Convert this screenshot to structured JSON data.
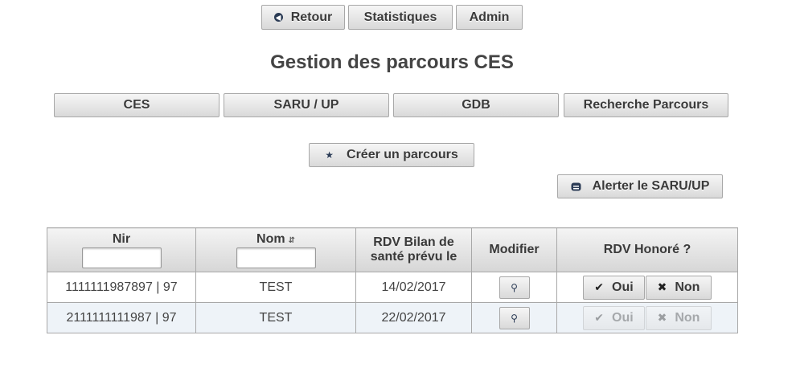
{
  "nav": {
    "back": "Retour",
    "stats": "Statistiques",
    "admin": "Admin"
  },
  "page_title": "Gestion des parcours CES",
  "tabs": [
    "CES",
    "SARU / UP",
    "GDB",
    "Recherche Parcours"
  ],
  "actions": {
    "create": "Créer un parcours",
    "alert": "Alerter le SARU/UP"
  },
  "table": {
    "headers": {
      "nir": "Nir",
      "nom": "Nom",
      "rdv_line1": "RDV Bilan de",
      "rdv_line2": "santé prévu le",
      "modifier": "Modifier",
      "honore": "RDV Honoré ?"
    },
    "rows": [
      {
        "nir": "1111111987897 | 97",
        "nom": "TEST",
        "date": "14/02/2017",
        "oui": "Oui",
        "non": "Non",
        "enabled": true
      },
      {
        "nir": "2111111111987 | 97",
        "nom": "TEST",
        "date": "22/02/2017",
        "oui": "Oui",
        "non": "Non",
        "enabled": false
      }
    ]
  }
}
